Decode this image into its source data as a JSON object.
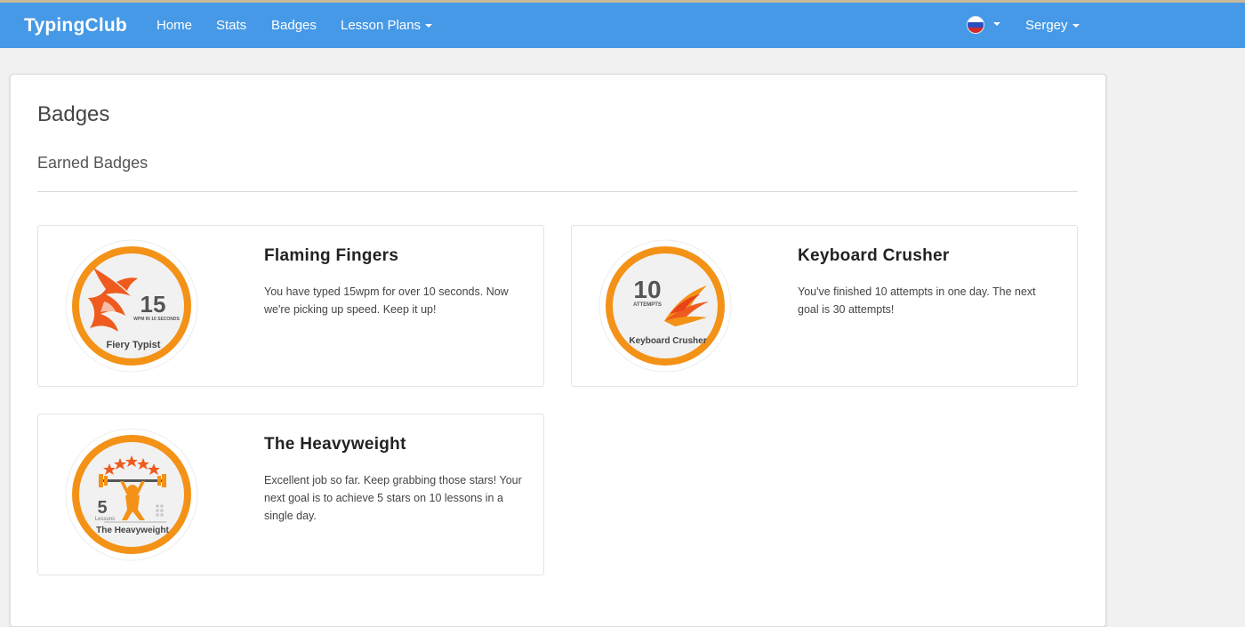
{
  "app": {
    "brand": "TypingClub"
  },
  "nav": {
    "items": [
      {
        "label": "Home"
      },
      {
        "label": "Stats"
      },
      {
        "label": "Badges"
      },
      {
        "label": "Lesson Plans"
      }
    ],
    "language_flag": "russia-flag-icon",
    "user": "Sergey"
  },
  "page": {
    "title": "Badges",
    "section": "Earned Badges"
  },
  "badges": [
    {
      "title": "Flaming Fingers",
      "description": "You have typed 15wpm for over 10 seconds. Now we're picking up speed. Keep it up!",
      "emblem": {
        "number": "15",
        "caption": "WPM IN 10 SECONDS",
        "name": "Fiery Typist",
        "icon": "flame-icon"
      }
    },
    {
      "title": "Keyboard Crusher",
      "description": "You've finished 10 attempts in one day. The next goal is 30 attempts!",
      "emblem": {
        "number": "10",
        "caption": "ATTEMPTS",
        "name": "Keyboard Crusher",
        "icon": "wing-icon"
      }
    },
    {
      "title": "The Heavyweight",
      "description": "Excellent job so far. Keep grabbing those stars! Your next goal is to achieve 5 stars on 10 lessons in a single day.",
      "emblem": {
        "number": "5",
        "caption": "Lessons",
        "name": "The Heavyweight",
        "icon": "weightlifter-icon"
      }
    }
  ],
  "colors": {
    "navbar": "#4699e6",
    "badge_ring": "#f39217",
    "badge_fill": "#f1f1f1",
    "flame": "#ef5a1e"
  }
}
